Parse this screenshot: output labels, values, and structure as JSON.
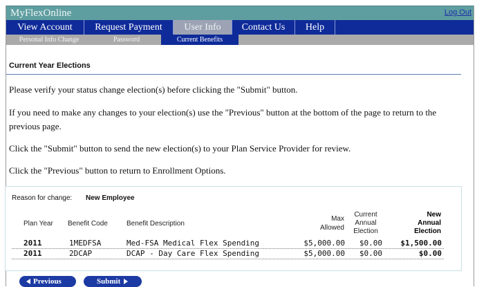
{
  "app": {
    "brand": "MyFlexOnline",
    "logout_label": "Log Out"
  },
  "nav": {
    "items": [
      {
        "label": "View Account"
      },
      {
        "label": "Request Payment"
      },
      {
        "label": "User Info"
      },
      {
        "label": "Contact Us"
      },
      {
        "label": "Help"
      }
    ],
    "active_index": 2
  },
  "subnav": {
    "items": [
      {
        "label": "Personal Info Change"
      },
      {
        "label": "Password"
      },
      {
        "label": "Current Benefits"
      }
    ],
    "active_index": 2
  },
  "main": {
    "heading": "Current Year Elections",
    "paragraphs": [
      "Please verify your status change election(s) before clicking the \"Submit\" button.",
      "If you need to make any changes to your election(s) use the \"Previous\" button at the bottom of the page to return to the previous page.",
      "Click the \"Submit\" button to send the new election(s) to your Plan Service Provider for review.",
      "Click the \"Previous\" button to return to Enrollment Options."
    ]
  },
  "elections": {
    "reason_label": "Reason for change:",
    "reason_value": "New Employee",
    "headers": {
      "plan_year": "Plan Year",
      "benefit_code": "Benefit Code",
      "benefit_description": "Benefit Description",
      "max_allowed_1": "Max",
      "max_allowed_2": "Allowed",
      "current_1": "Current",
      "current_2": "Annual",
      "current_3": "Election",
      "new_1": "New",
      "new_2": "Annual",
      "new_3": "Election"
    },
    "rows": [
      {
        "plan_year": "2011",
        "benefit_code": "1MEDFSA",
        "benefit_description": "Med-FSA Medical Flex Spending",
        "max_allowed": "$5,000.00",
        "current": "$0.00",
        "new": "$1,500.00"
      },
      {
        "plan_year": "2011",
        "benefit_code": "2DCAP",
        "benefit_description": "DCAP - Day Care Flex Spending",
        "max_allowed": "$5,000.00",
        "current": "$0.00",
        "new": "$0.00"
      }
    ]
  },
  "buttons": {
    "previous_label": "Previous",
    "submit_label": "Submit"
  },
  "colors": {
    "nav_bg": "#0f2b99",
    "title_bg": "#5f9ea0",
    "subnav_bg": "#aaaaaa",
    "button_bg": "#1c3aa3"
  }
}
